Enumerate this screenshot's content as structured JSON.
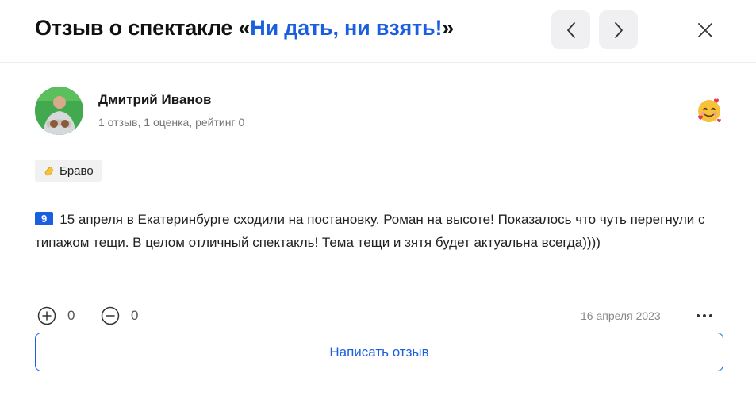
{
  "header": {
    "title_prefix": "Отзыв о спектакле «",
    "title_link": "Ни дать, ни взять!",
    "title_suffix": "»"
  },
  "review": {
    "author_name": "Дмитрий Иванов",
    "author_meta": "1 отзыв, 1 оценка, рейтинг 0",
    "reaction_emoji": "smiling-face-with-hearts-icon",
    "tag_label": "Браво",
    "rating": "9",
    "text": "15 апреля в Екатеринбурге сходили на постановку. Роман на высоте! Показалось что чуть перегнули с типажом тещи. В целом отличный спектакль! Тема тещи и зятя будет актуальна всегда))))",
    "likes": "0",
    "dislikes": "0",
    "date": "16 апреля 2023"
  },
  "actions": {
    "write_review": "Написать отзыв"
  },
  "colors": {
    "accent": "#1a5fe0"
  }
}
